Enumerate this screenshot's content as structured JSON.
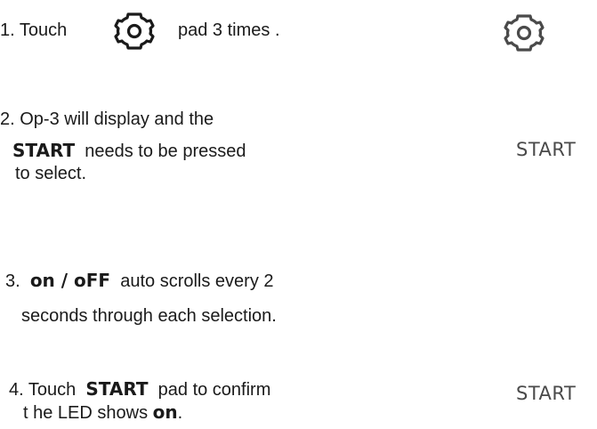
{
  "steps": [
    {
      "number": "1.",
      "prefix": "Touch",
      "icon": "gear-icon",
      "suffix": "pad 3 times ."
    },
    {
      "number": "2.",
      "line1": "Op-3 will display and the",
      "bold": "START",
      "line2_rest": "needs to be pressed",
      "line3": "to select."
    },
    {
      "number": "3.",
      "bold": "on / oFF",
      "line1_rest": "auto scrolls every 2",
      "line2": "seconds through each selection."
    },
    {
      "number": "4.",
      "prefix": "Touch",
      "bold": "START",
      "line1_rest": "pad to confirm",
      "line2_prefix": "t he LED shows",
      "line2_bold": "on",
      "line2_end": "."
    }
  ],
  "side": {
    "icon": "gear-icon",
    "start_label_1": "START",
    "start_label_2": "START"
  }
}
